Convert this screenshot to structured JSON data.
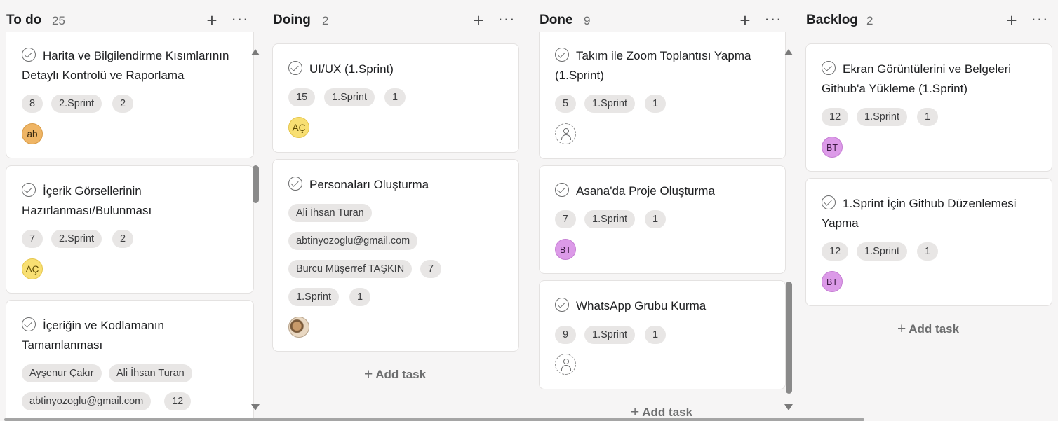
{
  "board": {
    "columns": [
      {
        "title": "To do",
        "count": "25",
        "cards": [
          {
            "title_line1": "Harita ve Bilgilendirme Kısımlarının",
            "title_line2": "Detaylı Kontrolü ve Raporlama",
            "tags": [
              "8",
              "2.Sprint",
              "2"
            ],
            "avatar": "ab"
          },
          {
            "title_line1": "İçerik Görsellerinin",
            "title_line2": "Hazırlanması/Bulunması",
            "tags": [
              "7",
              "2.Sprint",
              "2"
            ],
            "avatar": "AÇ"
          },
          {
            "title_line1": "İçeriğin ve Kodlamanın",
            "title_line2": "Tamamlanması",
            "tags": [
              "Ayşenur Çakır",
              "Ali İhsan Turan",
              "abtinyozoglu@gmail.com",
              "12"
            ]
          }
        ]
      },
      {
        "title": "Doing",
        "count": "2",
        "cards": [
          {
            "title_line1": "UI/UX (1.Sprint)",
            "tags": [
              "15",
              "1.Sprint",
              "1"
            ],
            "avatar": "AÇ"
          },
          {
            "title_line1": "Personaları Oluşturma",
            "tags": [
              "Ali İhsan Turan",
              "abtinyozoglu@gmail.com",
              "Burcu Müşerref TAŞKIN",
              "7",
              "1.Sprint",
              "1"
            ]
          }
        ],
        "add_task": "Add task"
      },
      {
        "title": "Done",
        "count": "9",
        "cards": [
          {
            "title_line1": "Takım ile Zoom Toplantısı Yapma",
            "title_line2": "(1.Sprint)",
            "tags": [
              "5",
              "1.Sprint",
              "1"
            ]
          },
          {
            "title_line1": "Asana'da Proje Oluşturma",
            "tags": [
              "7",
              "1.Sprint",
              "1"
            ],
            "avatar": "BT"
          },
          {
            "title_line1": "WhatsApp Grubu Kurma",
            "tags": [
              "9",
              "1.Sprint",
              "1"
            ]
          }
        ],
        "add_task": "Add task"
      },
      {
        "title": "Backlog",
        "count": "2",
        "cards": [
          {
            "title_line1": "Ekran Görüntülerini ve Belgeleri",
            "title_line2": "Github'a Yükleme (1.Sprint)",
            "tags": [
              "12",
              "1.Sprint",
              "1"
            ],
            "avatar": "BT"
          },
          {
            "title_line1": "1.Sprint İçin Github Düzenlemesi",
            "title_line2": "Yapma",
            "tags": [
              "12",
              "1.Sprint",
              "1"
            ],
            "avatar": "BT"
          }
        ],
        "add_task": "Add task"
      }
    ]
  },
  "icons": {
    "add_column_task": "plus-icon",
    "more": "more-horizontal-icon",
    "complete": "check-circle-icon",
    "unassigned": "person-icon"
  },
  "colors": {
    "avatar_ab": "#efb565",
    "avatar_ac": "#f8df72",
    "avatar_bt": "#dc9ae8"
  }
}
